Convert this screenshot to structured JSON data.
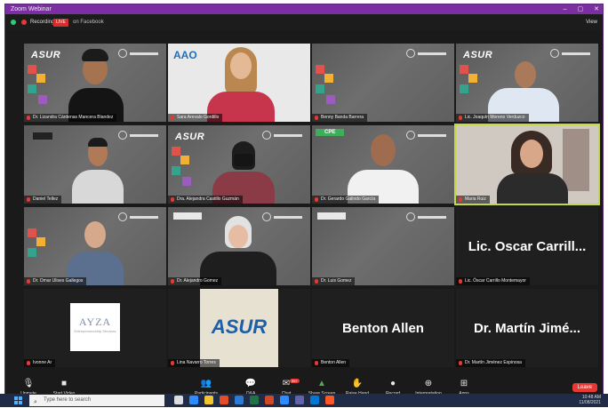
{
  "window": {
    "title": "Zoom Webinar",
    "controls": [
      "–",
      "▢",
      "✕"
    ]
  },
  "status": {
    "recording": "Recording",
    "live": "LIVE",
    "stream": "on Facebook",
    "view": "View"
  },
  "tiles": [
    {
      "name": "Dr. Lizandra Cárdenas Mancera Blandez",
      "logo": "ASUR",
      "kind": "person"
    },
    {
      "name": "Sara Arevalo Gordillo",
      "logo": "AAO",
      "kind": "person"
    },
    {
      "name": "Benny Banda Barrera",
      "logo": "",
      "kind": "empty"
    },
    {
      "name": "Lic. Joaquín Moreno Verduzco",
      "logo": "ASUR",
      "kind": "person"
    },
    {
      "name": "Daniel Tellez",
      "logo": "",
      "kind": "person"
    },
    {
      "name": "Dra. Alejandra Castillo Guzmán",
      "logo": "ASUR",
      "kind": "person"
    },
    {
      "name": "Dr. Gerardo Galindo García",
      "logo": "CPE",
      "kind": "person"
    },
    {
      "name": "Maria Ruiz",
      "logo": "",
      "kind": "person"
    },
    {
      "name": "Dr. Omar Ulises Gallegos",
      "logo": "",
      "kind": "person"
    },
    {
      "name": "Dr. Alejandro Gomez",
      "logo": "",
      "kind": "person"
    },
    {
      "name": "Dr. Luis Gomez",
      "logo": "",
      "kind": "empty"
    },
    {
      "name": "Lic. Óscar Carrillo Montemayor",
      "big": "Lic. Oscar Carrill...",
      "kind": "text"
    },
    {
      "name": "Ivonne Ar",
      "logo": "AYZA",
      "kind": "logo-ayza"
    },
    {
      "name": "Lina Navarro Torres",
      "logo": "ASUR",
      "kind": "logo-asur"
    },
    {
      "name": "Benton Allen",
      "big": "Benton Allen",
      "kind": "text"
    },
    {
      "name": "Dr. Martín Jiménez Espinosa",
      "big": "Dr. Martín Jimé...",
      "kind": "text"
    }
  ],
  "ayza": {
    "title": "AYZA",
    "subtitle": "Entrepreneurship Services"
  },
  "asur_big": "ASUR",
  "toolbar": {
    "mute": "Unmute",
    "video": "Start Video",
    "participants": "Participants",
    "participants_count": "127",
    "qa": "Q&A",
    "chat": "Chat",
    "chat_badge": "99+",
    "share": "Share Screen",
    "raise": "Raise Hand",
    "record": "Record",
    "reactions": "Interpretation",
    "apps": "Apps",
    "end": "Leave"
  },
  "taskbar": {
    "search_placeholder": "Type here to search",
    "time": "10:48 AM",
    "date": "11/08/2021"
  },
  "colors": {
    "accent": "#7b2fa3",
    "active_border": "#c4d940",
    "live": "#d32f2f",
    "leave": "#e53935"
  }
}
